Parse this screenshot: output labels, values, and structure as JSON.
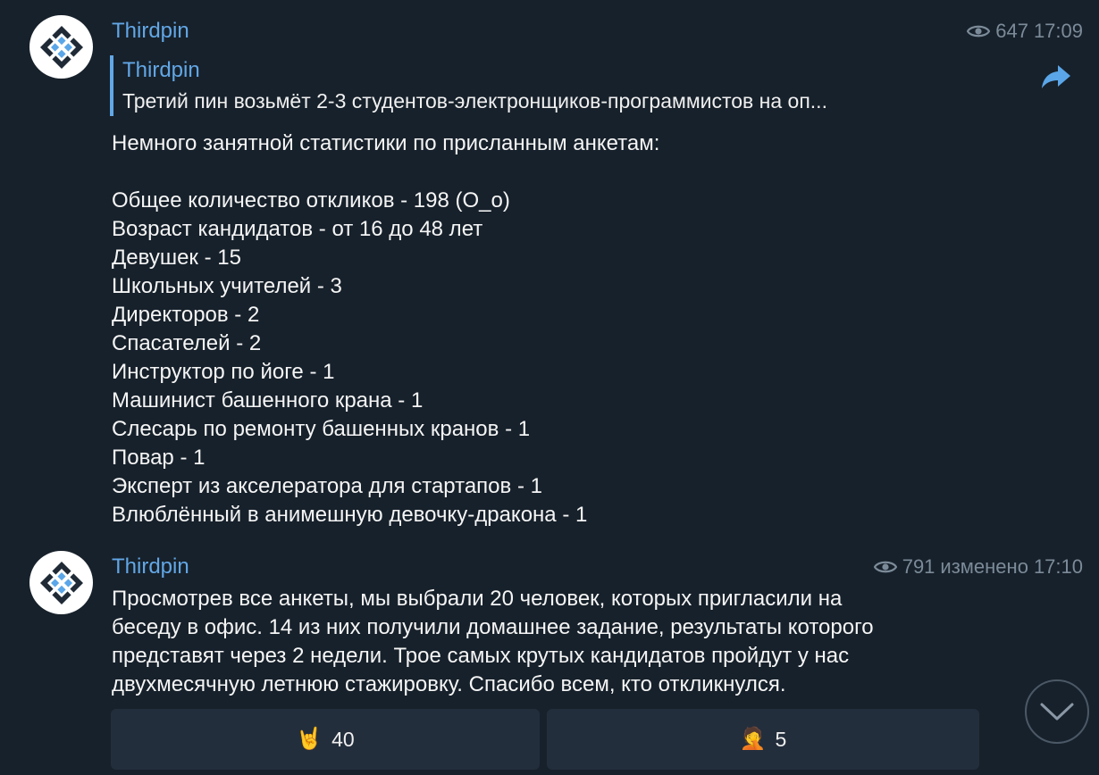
{
  "messages": [
    {
      "sender": "Thirdpin",
      "views": "647",
      "time": "17:09",
      "reply": {
        "sender": "Thirdpin",
        "text": "Третий пин возьмёт 2-3 студентов-электронщиков-программистов на оп..."
      },
      "text": "Немного занятной статистики по присланным анкетам:\n\nОбщее количество откликов - 198 (О_о)\nВозраст кандидатов - от 16 до 48 лет\nДевушек - 15\nШкольных учителей - 3\nДиректоров - 2\nСпасателей - 2\nИнструктор по йоге - 1\nМашинист башенного крана - 1\nСлесарь по ремонту башенных кранов - 1\nПовар - 1\nЭксперт из акселератора для стартапов - 1\nВлюблённый в анимешную девочку-дракона - 1"
    },
    {
      "sender": "Thirdpin",
      "views": "791",
      "edited": "изменено",
      "time": "17:10",
      "text": "Просмотрев все анкеты, мы выбрали 20 человек, которых пригласили на\nбеседу в офис. 14 из них получили домашнее задание, результаты которого\nпредставят через 2 недели. Трое самых крутых кандидатов пройдут у нас\nдвухмесячную летнюю стажировку. Спасибо всем, кто откликнулся.",
      "reactions": [
        {
          "emoji": "🤘",
          "count": "40"
        },
        {
          "emoji": "🤦",
          "count": "5"
        }
      ]
    }
  ],
  "icons": {
    "views": "eye-icon",
    "forward": "share-arrow-icon",
    "scroll": "chevron-down-icon",
    "avatar": "thirdpin-logo"
  },
  "colors": {
    "background": "#17212b",
    "accent": "#62a7e6",
    "muted": "#7c8b99",
    "reaction_bg": "#232e3c"
  }
}
